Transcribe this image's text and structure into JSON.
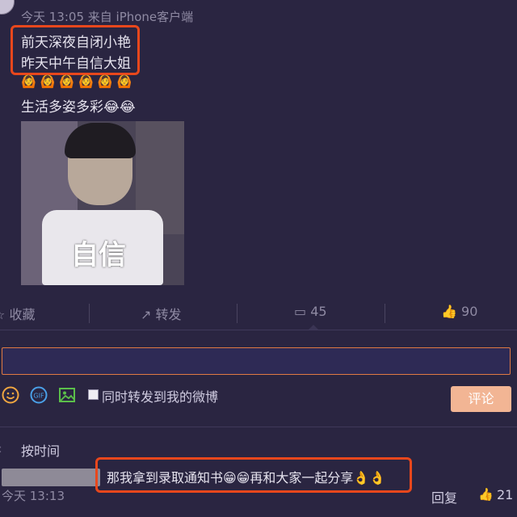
{
  "post": {
    "meta": "今天 13:05 来自 iPhone客户端",
    "line1": "前天深夜自闭小艳",
    "line2": "昨天中午自信大姐",
    "emoji_row": [
      "🙆",
      "🙆",
      "🙆",
      "🙆",
      "🙆",
      "🙆"
    ],
    "line3": "生活多姿多彩",
    "line3_emoji": "😂😂",
    "image_text": "自信"
  },
  "actions": {
    "favorite_label": "收藏",
    "repost_label": "转发",
    "comment_count": "45",
    "like_count": "90"
  },
  "composer": {
    "input_value": "",
    "repost_checkbox_label": "同时转发到我的微博",
    "submit_label": "评论"
  },
  "comments": {
    "sort_label": "按时间",
    "items": [
      {
        "text": "那我拿到录取通知书😁😁再和大家一起分享👌👌",
        "time": "今天 13:13",
        "reply_label": "回复",
        "likes": "21"
      }
    ]
  },
  "colors": {
    "background": "#2a2541",
    "highlight": "#e8471c",
    "accent": "#f2b594"
  }
}
